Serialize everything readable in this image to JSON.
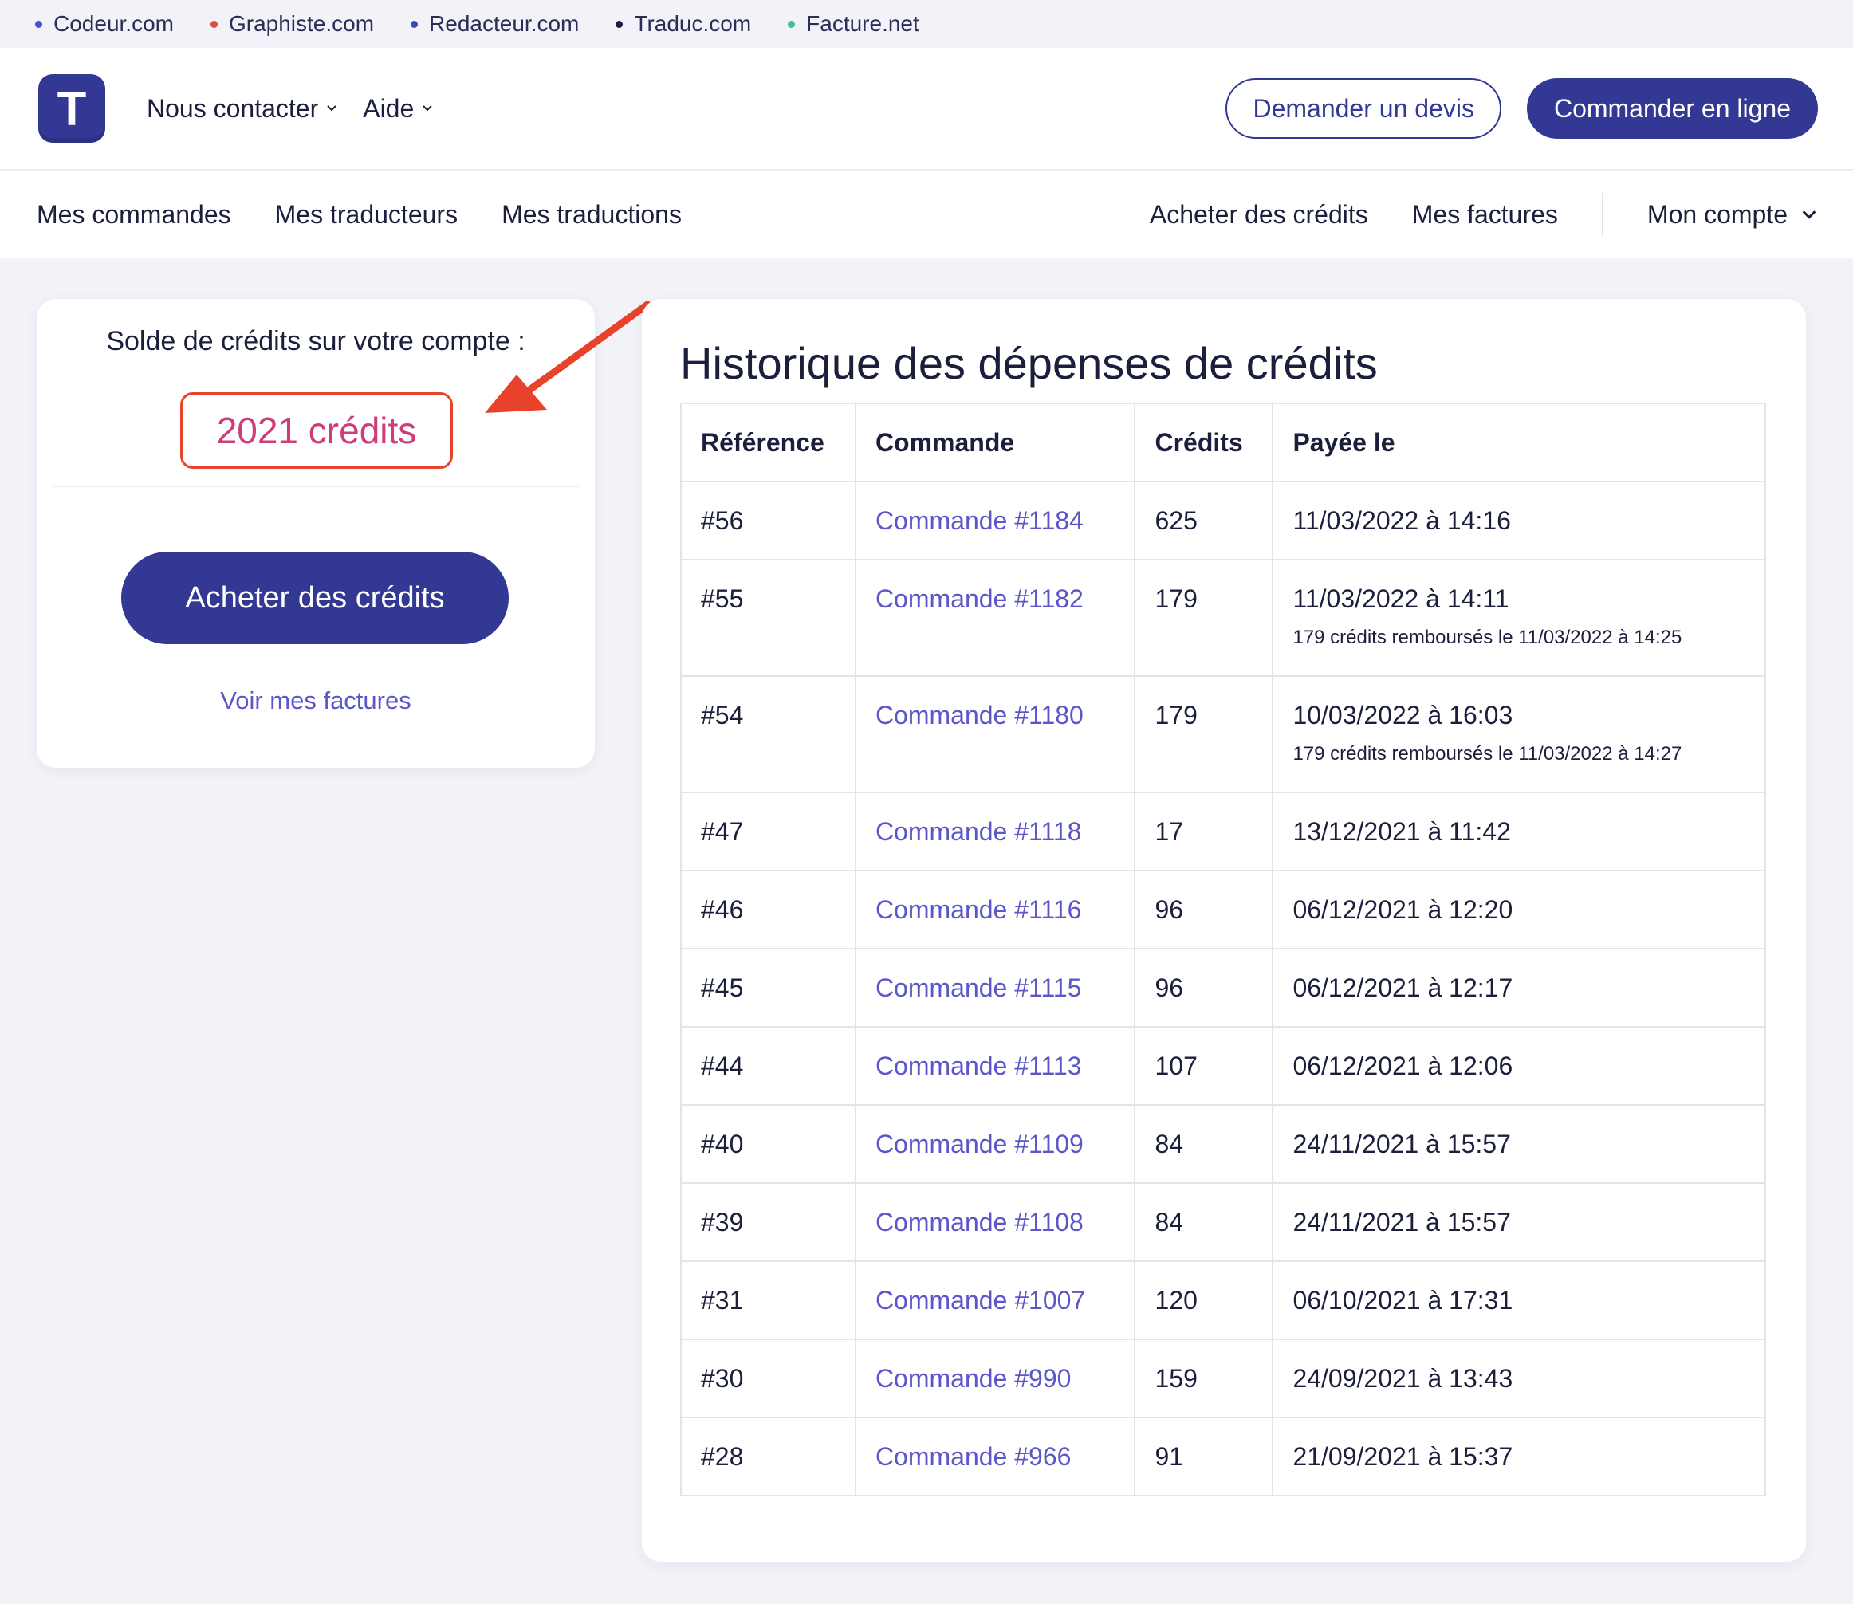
{
  "network": [
    {
      "label": "Codeur.com",
      "color": "#3e55d6"
    },
    {
      "label": "Graphiste.com",
      "color": "#e04a3f"
    },
    {
      "label": "Redacteur.com",
      "color": "#3b4bb0"
    },
    {
      "label": "Traduc.com",
      "color": "#1b1f3b"
    },
    {
      "label": "Facture.net",
      "color": "#3fc48d"
    }
  ],
  "header": {
    "logo_letter": "T",
    "nav": [
      "Nous contacter",
      "Aide"
    ],
    "quote_button": "Demander un devis",
    "order_button": "Commander en ligne"
  },
  "subnav": {
    "left": [
      "Mes commandes",
      "Mes traducteurs",
      "Mes traductions"
    ],
    "buy_credits": "Acheter des crédits",
    "invoices": "Mes factures",
    "account": "Mon compte"
  },
  "balance": {
    "title": "Solde de crédits sur votre compte :",
    "value": "2021 crédits",
    "buy_button": "Acheter des crédits",
    "invoices_link": "Voir mes factures"
  },
  "history": {
    "title": "Historique des dépenses de crédits",
    "columns": [
      "Référence",
      "Commande",
      "Crédits",
      "Payée le"
    ],
    "rows": [
      {
        "ref": "#56",
        "order": "Commande #1184",
        "credits": "625",
        "paid": "11/03/2022 à 14:16",
        "note": ""
      },
      {
        "ref": "#55",
        "order": "Commande #1182",
        "credits": "179",
        "paid": "11/03/2022 à 14:11",
        "note": "179 crédits remboursés le 11/03/2022 à 14:25"
      },
      {
        "ref": "#54",
        "order": "Commande #1180",
        "credits": "179",
        "paid": "10/03/2022 à 16:03",
        "note": "179 crédits remboursés le 11/03/2022 à 14:27"
      },
      {
        "ref": "#47",
        "order": "Commande #1118",
        "credits": "17",
        "paid": "13/12/2021 à 11:42",
        "note": ""
      },
      {
        "ref": "#46",
        "order": "Commande #1116",
        "credits": "96",
        "paid": "06/12/2021 à 12:20",
        "note": ""
      },
      {
        "ref": "#45",
        "order": "Commande #1115",
        "credits": "96",
        "paid": "06/12/2021 à 12:17",
        "note": ""
      },
      {
        "ref": "#44",
        "order": "Commande #1113",
        "credits": "107",
        "paid": "06/12/2021 à 12:06",
        "note": ""
      },
      {
        "ref": "#40",
        "order": "Commande #1109",
        "credits": "84",
        "paid": "24/11/2021 à 15:57",
        "note": ""
      },
      {
        "ref": "#39",
        "order": "Commande #1108",
        "credits": "84",
        "paid": "24/11/2021 à 15:57",
        "note": ""
      },
      {
        "ref": "#31",
        "order": "Commande #1007",
        "credits": "120",
        "paid": "06/10/2021 à 17:31",
        "note": ""
      },
      {
        "ref": "#30",
        "order": "Commande #990",
        "credits": "159",
        "paid": "24/09/2021 à 13:43",
        "note": ""
      },
      {
        "ref": "#28",
        "order": "Commande #966",
        "credits": "91",
        "paid": "21/09/2021 à 15:37",
        "note": ""
      }
    ]
  },
  "colors": {
    "brand": "#333894",
    "link": "#5b57c8",
    "highlight": "#e8432a",
    "balance_text": "#d03b7a",
    "background": "#f2f2f8"
  },
  "icons": {
    "dropdown": "chevron-down-icon",
    "annotation": "red-arrow-icon"
  }
}
